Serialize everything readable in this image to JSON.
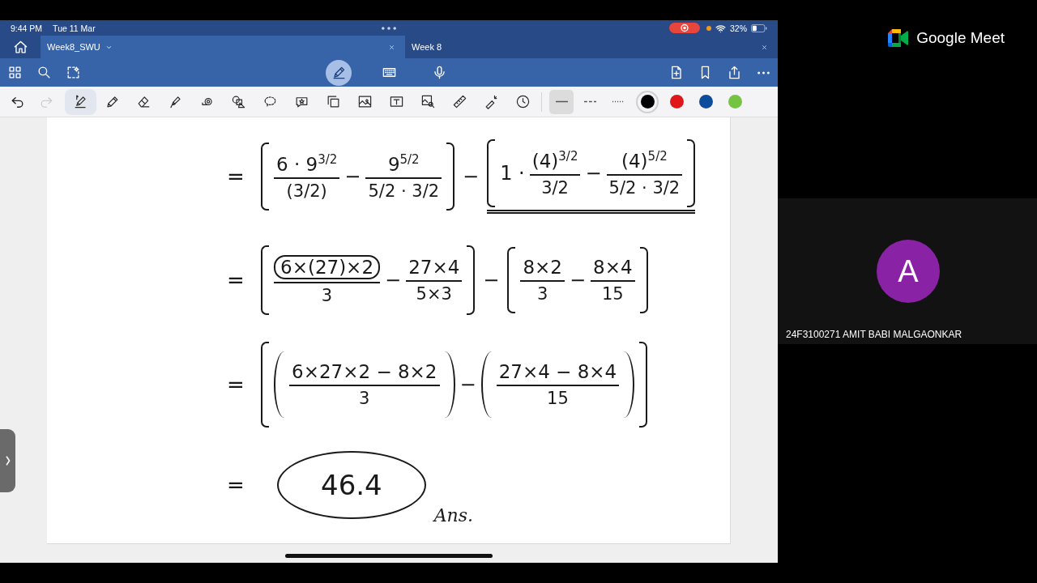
{
  "status_bar": {
    "time": "9:44 PM",
    "date": "Tue 11 Mar",
    "battery": "32%"
  },
  "tabs": [
    {
      "label": "Week8_SWU",
      "selected": true
    },
    {
      "label": "Week 8",
      "selected": false
    }
  ],
  "input_modes": [
    {
      "selected": true
    },
    {
      "selected": false
    },
    {
      "selected": false
    }
  ],
  "history": [
    {
      "disabled": false
    },
    {
      "disabled": true
    }
  ],
  "tools": [
    {
      "selected": true
    },
    {
      "selected": false
    },
    {
      "selected": false
    },
    {
      "selected": false
    },
    {
      "selected": false
    },
    {
      "selected": false
    },
    {
      "selected": false
    },
    {
      "selected": false
    },
    {
      "selected": false
    },
    {
      "selected": false
    },
    {
      "selected": false
    },
    {
      "selected": false
    },
    {
      "selected": false
    },
    {
      "selected": false
    },
    {
      "selected": false
    }
  ],
  "line_styles": [
    {
      "kind": "solid",
      "selected": true
    },
    {
      "kind": "dashed",
      "selected": false
    },
    {
      "kind": "dotted",
      "selected": false
    }
  ],
  "colors": [
    {
      "color": "#000000",
      "selected": true
    },
    {
      "color": "#e0161b",
      "selected": false
    },
    {
      "color": "#0b4c9c",
      "selected": false
    },
    {
      "color": "#74c442",
      "selected": false
    }
  ],
  "notes": {
    "rows": [
      {
        "sign": "=",
        "items": [
          {
            "kind": "brackets",
            "underlined": false,
            "items": [
              {
                "kind": "frac",
                "num": "6 · 9$^{3/2}$",
                "den": "(3/2)",
                "boxed": false
              },
              {
                "kind": "sign",
                "text": "−"
              },
              {
                "kind": "frac",
                "num": "9$^{5/2}$",
                "den": "5/2 · 3/2",
                "boxed": false
              }
            ]
          },
          {
            "kind": "sign",
            "text": "−"
          },
          {
            "kind": "brackets",
            "underlined": true,
            "items": [
              {
                "kind": "sign",
                "text": "1 ·"
              },
              {
                "kind": "frac",
                "num": "(4)$^{3/2}$",
                "den": "3/2",
                "boxed": false
              },
              {
                "kind": "sign",
                "text": "−"
              },
              {
                "kind": "frac",
                "num": "(4)$^{5/2}$",
                "den": "5/2 · 3/2",
                "boxed": false
              }
            ]
          }
        ]
      },
      {
        "sign": "=",
        "items": [
          {
            "kind": "brackets",
            "underlined": false,
            "items": [
              {
                "kind": "frac",
                "num": "6×(27)×2",
                "den": "3",
                "boxed": true
              },
              {
                "kind": "sign",
                "text": "−"
              },
              {
                "kind": "frac",
                "num": "27×4",
                "den": "5×3",
                "boxed": false
              }
            ]
          },
          {
            "kind": "sign",
            "text": "−"
          },
          {
            "kind": "brackets",
            "underlined": false,
            "items": [
              {
                "kind": "frac",
                "num": "8×2",
                "den": "3",
                "boxed": false
              },
              {
                "kind": "sign",
                "text": "−"
              },
              {
                "kind": "frac",
                "num": "8×4",
                "den": "15",
                "boxed": false
              }
            ]
          }
        ]
      },
      {
        "sign": "=",
        "items": [
          {
            "kind": "brackets",
            "underlined": false,
            "items": [
              {
                "kind": "parens",
                "underlined": false,
                "items": [
                  {
                    "kind": "frac",
                    "num": "6×27×2 − 8×2",
                    "den": "3",
                    "boxed": false
                  }
                ]
              },
              {
                "kind": "sign",
                "text": "−"
              },
              {
                "kind": "parens",
                "underlined": false,
                "items": [
                  {
                    "kind": "frac",
                    "num": "27×4 − 8×4",
                    "den": "15",
                    "boxed": false
                  }
                ]
              }
            ]
          }
        ]
      },
      {
        "sign": "=",
        "items": [
          {
            "kind": "answer",
            "text": "46.4"
          },
          {
            "kind": "note",
            "text": "Ans."
          }
        ]
      }
    ]
  },
  "meet": {
    "brand": "Google Meet",
    "participant": {
      "initial": "A",
      "name": "24F3100271 AMIT BABI MALGAONKAR"
    }
  }
}
